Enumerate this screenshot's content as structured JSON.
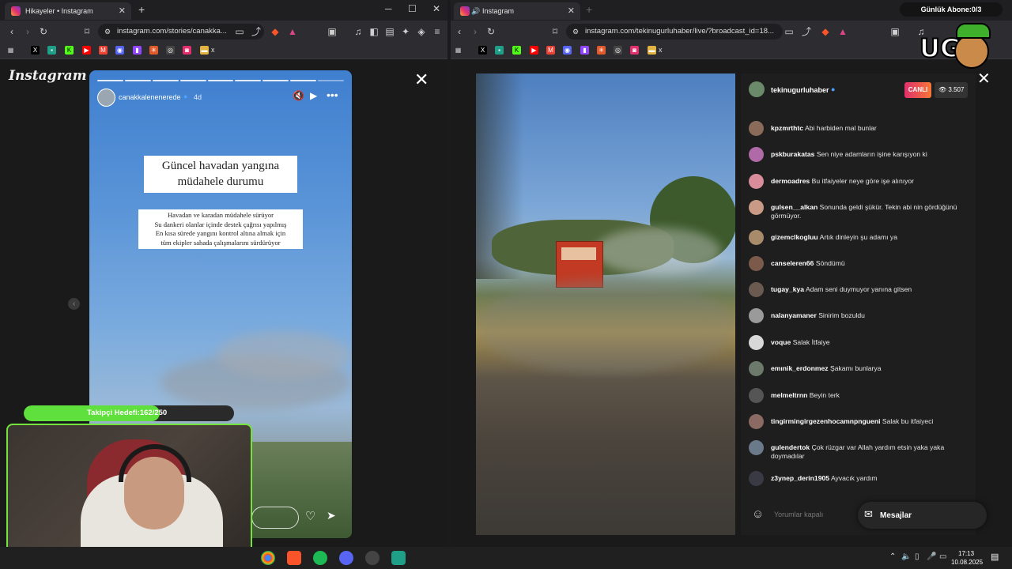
{
  "left_window": {
    "tab_title": "Hikayeler • Instagram",
    "url": "instagram.com/stories/canakka...",
    "bookmark_last": "x"
  },
  "right_window": {
    "tab_title": "Instagram",
    "url": "instagram.com/tekinugurluhaber/live/?broadcast_id=18...",
    "bookmark_last": "x"
  },
  "overlay": {
    "subscriber_goal": "Günlük Abone:0/3",
    "follower_goal_label": "Takipçi Hedefi:162/250",
    "follower_goal_fraction": 0.648
  },
  "story": {
    "brand": "Instagram",
    "username": "canakkalenenerede",
    "age": "4d",
    "headline_line1": "Güncel havadan yangına",
    "headline_line2": "müdahele durumu",
    "body_line1": "Havadan ve karadan müdahele sürüyor",
    "body_line2": "Su dankeri olanlar içinde destek çağrısı yapılmış",
    "body_line3": "En kısa sürede yangını kontrol altına almak için",
    "body_line4": "tüm ekipler sahada çalışmalarını sürdürüyor"
  },
  "live": {
    "username": "tekinugurluhaber",
    "badge": "CANLI",
    "viewers": "3.507",
    "comment_placeholder": "Yorumlar kapalı",
    "messages_label": "Mesajlar",
    "comments": [
      {
        "user": "kpzmrthtc",
        "text": "Abi harbiden mal bunlar",
        "color": "#8a6b5a"
      },
      {
        "user": "pskburakatas",
        "text": "Sen niye adamların işine karışıyon ki",
        "color": "#b06aa8"
      },
      {
        "user": "dermoadres",
        "text": "Bu itfaiyeler neye göre işe alınıyor",
        "color": "#d98c9a"
      },
      {
        "user": "gulsen__alkan",
        "text": "Sonunda geldi şükür. Tekin abi nin gördüğünü görmüyor.",
        "color": "#c99b86"
      },
      {
        "user": "gizemclkogluu",
        "text": "Artık dinleyin şu adamı ya",
        "color": "#a88b6a"
      },
      {
        "user": "canseleren66",
        "text": "Söndümü",
        "color": "#7b5a4c"
      },
      {
        "user": "tugay_kya",
        "text": "Adam seni duymuyor yanına gitsen",
        "color": "#6a5a50"
      },
      {
        "user": "nalanyamaner",
        "text": "Sinirim bozuldu",
        "color": "#9a9a9a"
      },
      {
        "user": "voque",
        "text": "Salak İtfaiye",
        "color": "#d8d8d8"
      },
      {
        "user": "emınik_erdonmez",
        "text": "Şakamı bunlarya",
        "color": "#6b7a6a"
      },
      {
        "user": "melmeltrnn",
        "text": "Beyin terk",
        "color": "#555555"
      },
      {
        "user": "tingirmingirgezenhocamnpngueni",
        "text": "Salak bu itfaiyeci",
        "color": "#8a6a62"
      },
      {
        "user": "gulendertok",
        "text": "Çok rüzgar var Allah yardım etsin yaka yaka doymadılar",
        "color": "#6a7a8a"
      },
      {
        "user": "z3ynep_derin1905",
        "text": "Ayvacık yardım",
        "color": "#3a3a44"
      }
    ]
  },
  "taskbar": {
    "time": "17:13",
    "date": "10.08.2025"
  }
}
